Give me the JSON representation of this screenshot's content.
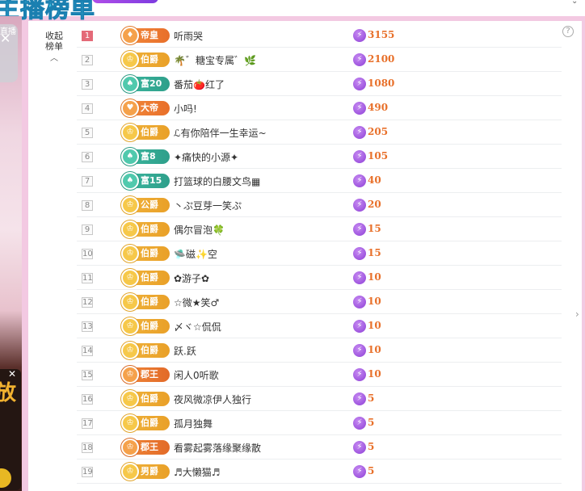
{
  "header": {
    "title": "主播榜单",
    "pill_label": "",
    "right_mark": "",
    "right_arrow": "⌄"
  },
  "left_strip": {
    "label": "直播",
    "close": "✕",
    "close2": "✕",
    "glyph": "放"
  },
  "panel": {
    "collapse_label": "收起榜单",
    "collapse_arrow": "︿",
    "help": "?",
    "right_arrow": "›"
  },
  "colors": {
    "score": "#e8702a",
    "rank_first": "#e46a78",
    "badge_gold": "#f0b33c",
    "badge_orange": "#f28a3c",
    "badge_teal": "#3cb8a0",
    "score_icon": "#8e3fd6"
  },
  "icons": {
    "score": "lightning-icon",
    "badge": "crown-icon"
  },
  "rows": [
    {
      "rank": "1",
      "badge": "帝皇",
      "badge_style": "orange",
      "badge_icon": "♦",
      "name": "听雨哭",
      "score": "3155"
    },
    {
      "rank": "2",
      "badge": "伯爵",
      "badge_style": "gold",
      "badge_icon": "♔",
      "name": "🌴゛糖宝专属゛🌿",
      "score": "2100"
    },
    {
      "rank": "3",
      "badge": "富20",
      "badge_style": "teal",
      "badge_icon": "♠",
      "name": "番茄🍅红了",
      "score": "1080"
    },
    {
      "rank": "4",
      "badge": "大帝",
      "badge_style": "orange",
      "badge_icon": "♥",
      "name": "小吗!",
      "score": "490"
    },
    {
      "rank": "5",
      "badge": "伯爵",
      "badge_style": "gold",
      "badge_icon": "♔",
      "name": "ℒ有你陪伴一生幸运~",
      "score": "205"
    },
    {
      "rank": "6",
      "badge": "富8",
      "badge_style": "teal",
      "badge_icon": "♠",
      "name": "✦痛快的小源✦",
      "score": "105"
    },
    {
      "rank": "7",
      "badge": "富15",
      "badge_style": "teal",
      "badge_icon": "♠",
      "name": "打篮球的白腰文鸟▦",
      "score": "40"
    },
    {
      "rank": "8",
      "badge": "公爵",
      "badge_style": "gold",
      "badge_icon": "♔",
      "name": "丶ぷ豆芽一笑ぷ",
      "score": "20"
    },
    {
      "rank": "9",
      "badge": "伯爵",
      "badge_style": "gold",
      "badge_icon": "♔",
      "name": "偶尔冒泡🍀",
      "score": "15"
    },
    {
      "rank": "10",
      "badge": "伯爵",
      "badge_style": "gold",
      "badge_icon": "♔",
      "name": "🛸磁✨空",
      "score": "15"
    },
    {
      "rank": "11",
      "badge": "伯爵",
      "badge_style": "gold",
      "badge_icon": "♔",
      "name": "✿游子✿",
      "score": "10"
    },
    {
      "rank": "12",
      "badge": "伯爵",
      "badge_style": "gold",
      "badge_icon": "♔",
      "name": "☆微★笑♂",
      "score": "10"
    },
    {
      "rank": "13",
      "badge": "伯爵",
      "badge_style": "gold",
      "badge_icon": "♔",
      "name": "〆ヾ☆侃侃",
      "score": "10"
    },
    {
      "rank": "14",
      "badge": "伯爵",
      "badge_style": "gold",
      "badge_icon": "♔",
      "name": "跃.跃",
      "score": "10"
    },
    {
      "rank": "15",
      "badge": "郡王",
      "badge_style": "red",
      "badge_icon": "♔",
      "name": "闲人0听歌",
      "score": "10"
    },
    {
      "rank": "16",
      "badge": "伯爵",
      "badge_style": "gold",
      "badge_icon": "♔",
      "name": "夜风微凉伊人独行",
      "score": "5"
    },
    {
      "rank": "17",
      "badge": "伯爵",
      "badge_style": "gold",
      "badge_icon": "♔",
      "name": "孤月独舞",
      "score": "5"
    },
    {
      "rank": "18",
      "badge": "郡王",
      "badge_style": "red",
      "badge_icon": "♔",
      "name": "看雾起雾落缘聚缘散",
      "score": "5"
    },
    {
      "rank": "19",
      "badge": "男爵",
      "badge_style": "gold",
      "badge_icon": "♔",
      "name": "♬大懒猫♬",
      "score": "5"
    }
  ]
}
